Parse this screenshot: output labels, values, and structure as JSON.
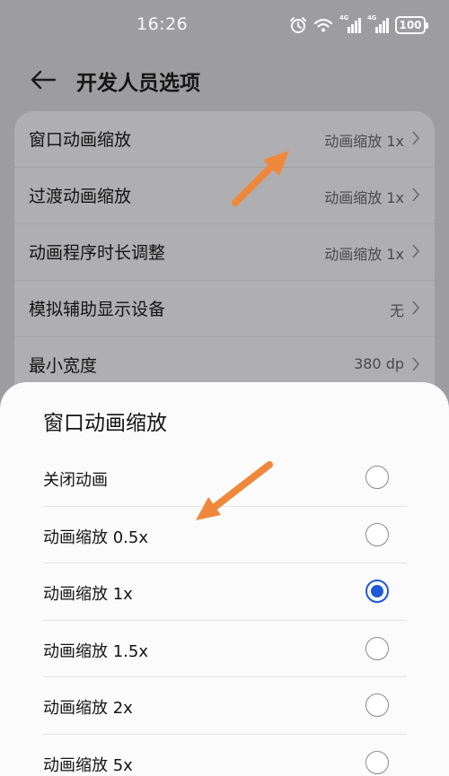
{
  "status_bar": {
    "time": "16:26",
    "icons": [
      "alarm-icon",
      "wifi-icon",
      "signal-4g-icon",
      "signal-4g-icon",
      "battery-icon"
    ],
    "network_1": "4G",
    "network_2": "4G",
    "battery": "100"
  },
  "header": {
    "title": "开发人员选项"
  },
  "settings": {
    "items": [
      {
        "label": "窗口动画缩放",
        "value": "动画缩放 1x"
      },
      {
        "label": "过渡动画缩放",
        "value": "动画缩放 1x"
      },
      {
        "label": "动画程序时长调整",
        "value": "动画缩放 1x"
      },
      {
        "label": "模拟辅助显示设备",
        "value": "无"
      },
      {
        "label": "最小宽度",
        "value": "380 dp"
      }
    ]
  },
  "sheet": {
    "title": "窗口动画缩放",
    "options": [
      {
        "label": "关闭动画",
        "selected": false
      },
      {
        "label": "动画缩放 0.5x",
        "selected": false
      },
      {
        "label": "动画缩放 1x",
        "selected": true
      },
      {
        "label": "动画缩放 1.5x",
        "selected": false
      },
      {
        "label": "动画缩放 2x",
        "selected": false
      },
      {
        "label": "动画缩放 5x",
        "selected": false
      }
    ]
  },
  "colors": {
    "accent": "#1e58d6",
    "annotation_arrow": "#f0883c",
    "dim_background": "#9d9d9f"
  }
}
